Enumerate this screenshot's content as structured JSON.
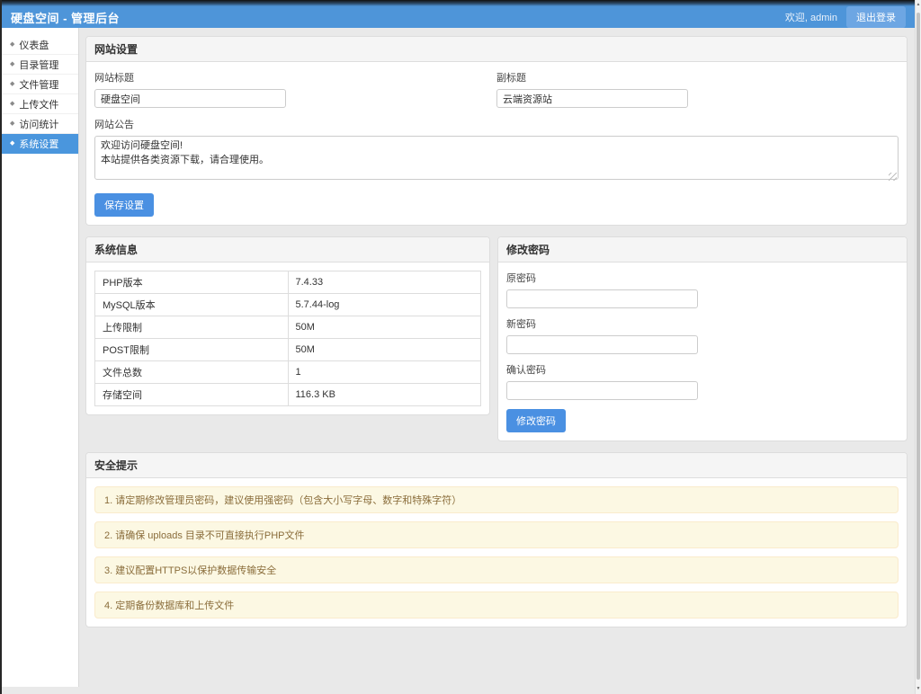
{
  "colors": {
    "header_bg": "#4e95d9",
    "accent_button": "#4a90e2",
    "sidebar_active_bg": "#4a96dd",
    "panel_header_bg": "#f5f5f5",
    "alert_bg": "#fcf8e3",
    "alert_border": "#faebcc",
    "alert_text": "#8a6d3b"
  },
  "icons": {
    "sidebar_bullet": "◆",
    "scroll_up": "▲",
    "scroll_down": "▼"
  },
  "header": {
    "title": "硬盘空间 - 管理后台",
    "welcome": "欢迎, admin",
    "logout_label": "退出登录"
  },
  "sidebar": {
    "items": [
      {
        "label": "仪表盘"
      },
      {
        "label": "目录管理"
      },
      {
        "label": "文件管理"
      },
      {
        "label": "上传文件"
      },
      {
        "label": "访问统计"
      },
      {
        "label": "系统设置"
      }
    ],
    "active_item": "系统设置"
  },
  "site_settings": {
    "panel_title": "网站设置",
    "site_title_label": "网站标题",
    "site_title_value": "硬盘空间",
    "subtitle_label": "副标题",
    "subtitle_value": "云端资源站",
    "announcement_label": "网站公告",
    "announcement_value": "欢迎访问硬盘空间!\n本站提供各类资源下载，请合理使用。",
    "save_label": "保存设置"
  },
  "system_info": {
    "panel_title": "系统信息",
    "rows": [
      {
        "label": "PHP版本",
        "value": "7.4.33"
      },
      {
        "label": "MySQL版本",
        "value": "5.7.44-log"
      },
      {
        "label": "上传限制",
        "value": "50M"
      },
      {
        "label": "POST限制",
        "value": "50M"
      },
      {
        "label": "文件总数",
        "value": "1"
      },
      {
        "label": "存储空间",
        "value": "116.3 KB"
      }
    ]
  },
  "change_password": {
    "panel_title": "修改密码",
    "old_password_label": "原密码",
    "new_password_label": "新密码",
    "confirm_password_label": "确认密码",
    "submit_label": "修改密码"
  },
  "security_tips": {
    "panel_title": "安全提示",
    "tips": [
      "1. 请定期修改管理员密码，建议使用强密码（包含大小写字母、数字和特殊字符）",
      "2. 请确保 uploads 目录不可直接执行PHP文件",
      "3. 建议配置HTTPS以保护数据传输安全",
      "4. 定期备份数据库和上传文件"
    ]
  }
}
